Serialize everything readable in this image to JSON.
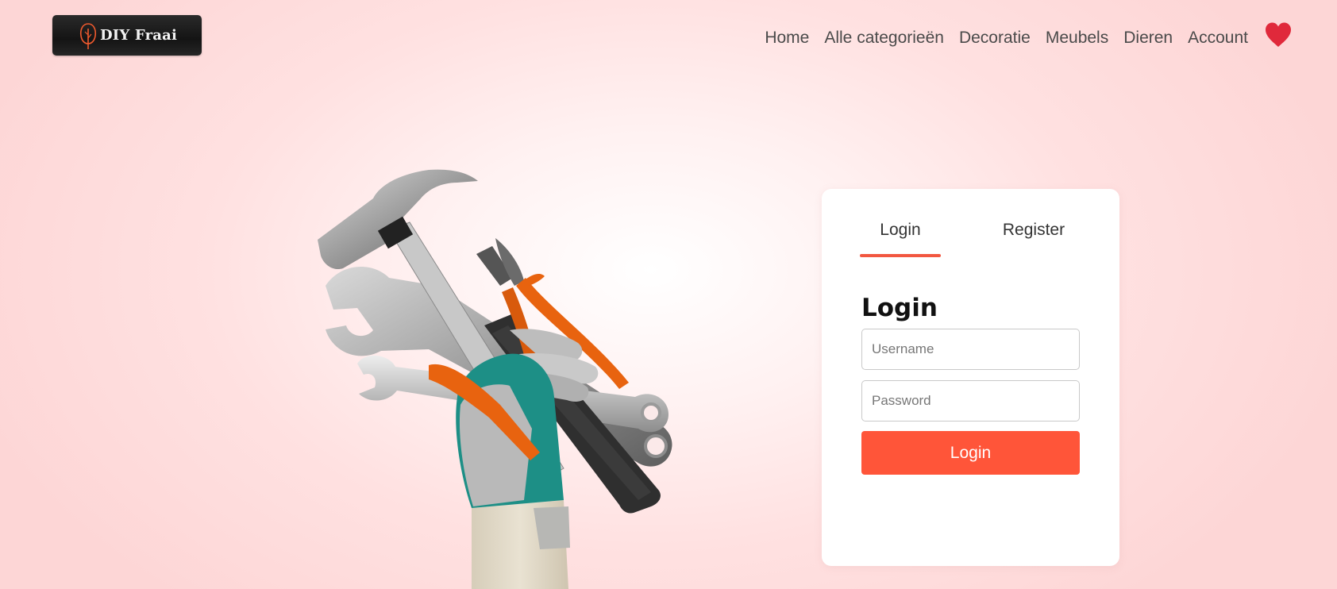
{
  "header": {
    "logo_text": "DIY Fraai",
    "nav": [
      "Home",
      "Alle categorieën",
      "Decoratie",
      "Meubels",
      "Dieren",
      "Account"
    ],
    "favorites_icon": "heart-icon"
  },
  "colors": {
    "accent": "#ff5539",
    "heart": "#e0293b",
    "logo_bg": "#1f1f1f"
  },
  "auth": {
    "tabs": [
      "Login",
      "Register"
    ],
    "active_tab": "Login",
    "form_title": "Login",
    "username_placeholder": "Username",
    "password_placeholder": "Password",
    "submit_label": "Login"
  }
}
